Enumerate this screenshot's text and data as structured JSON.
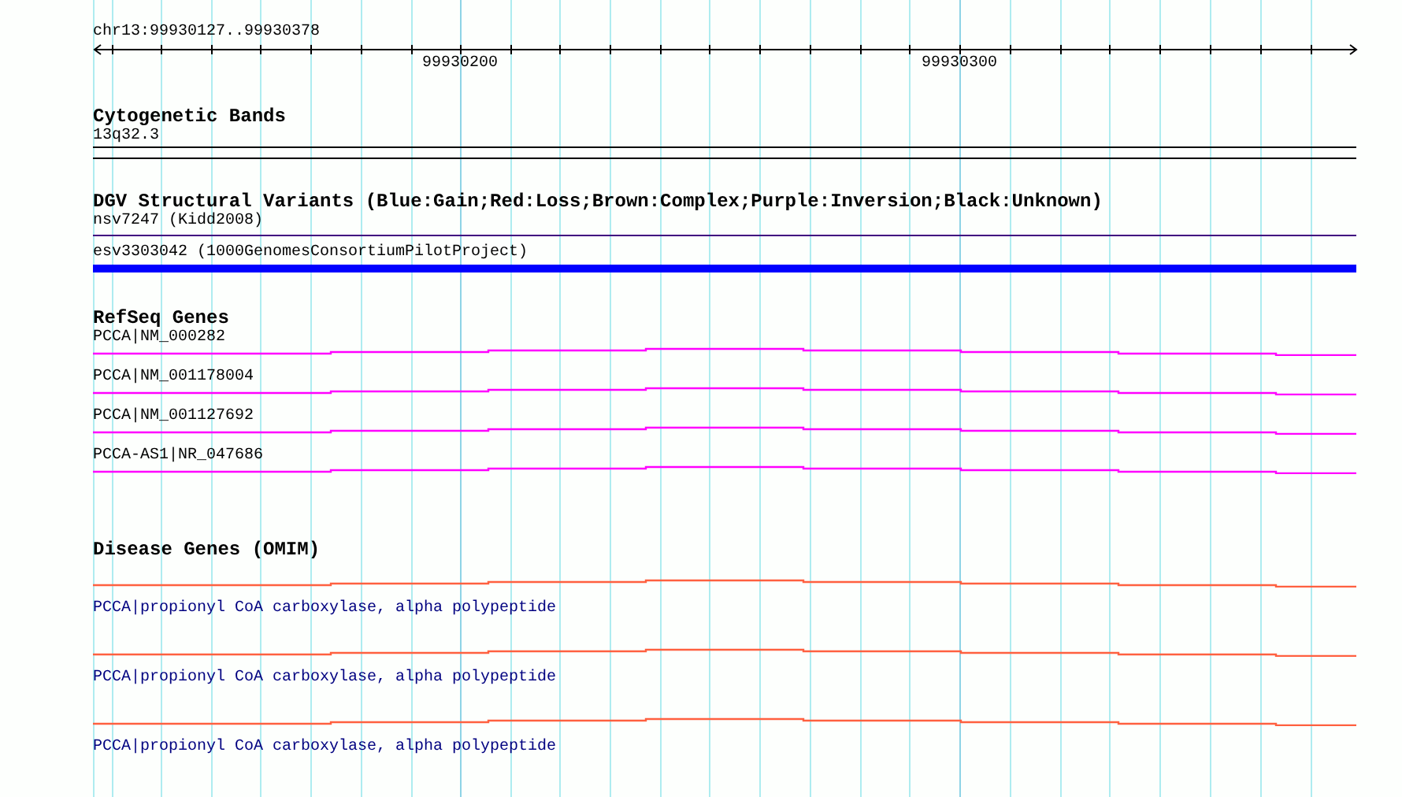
{
  "ruler": {
    "range": "chr13:99930127..99930378",
    "ticks": [
      {
        "label": "99930200"
      },
      {
        "label": "99930300"
      }
    ]
  },
  "tracks": [
    {
      "kind": "band",
      "title": "Cytogenetic Bands",
      "features": [
        {
          "label": "13q32.3"
        }
      ]
    },
    {
      "kind": "variant",
      "title": "DGV Structural Variants (Blue:Gain;Red:Loss;Brown:Complex;Purple:Inversion;Black:Unknown)",
      "features": [
        {
          "kind": "line",
          "label": "nsv7247 (Kidd2008)",
          "color": "#400080"
        },
        {
          "kind": "bar",
          "label": "esv3303042 (1000GenomesConsortiumPilotProject)",
          "color": "#0000ff"
        }
      ]
    },
    {
      "kind": "transcript",
      "title": "RefSeq Genes",
      "features": [
        {
          "label": "PCCA|NM_000282"
        },
        {
          "label": "PCCA|NM_001178004"
        },
        {
          "label": "PCCA|NM_001127692"
        },
        {
          "label": "PCCA-AS1|NR_047686"
        }
      ]
    },
    {
      "kind": "disease",
      "title": "Disease Genes (OMIM)",
      "features": [
        {
          "label": "PCCA|propionyl CoA carboxylase, alpha polypeptide"
        },
        {
          "label": "PCCA|propionyl CoA carboxylase, alpha polypeptide"
        },
        {
          "label": "PCCA|propionyl CoA carboxylase, alpha polypeptide"
        }
      ]
    }
  ]
}
